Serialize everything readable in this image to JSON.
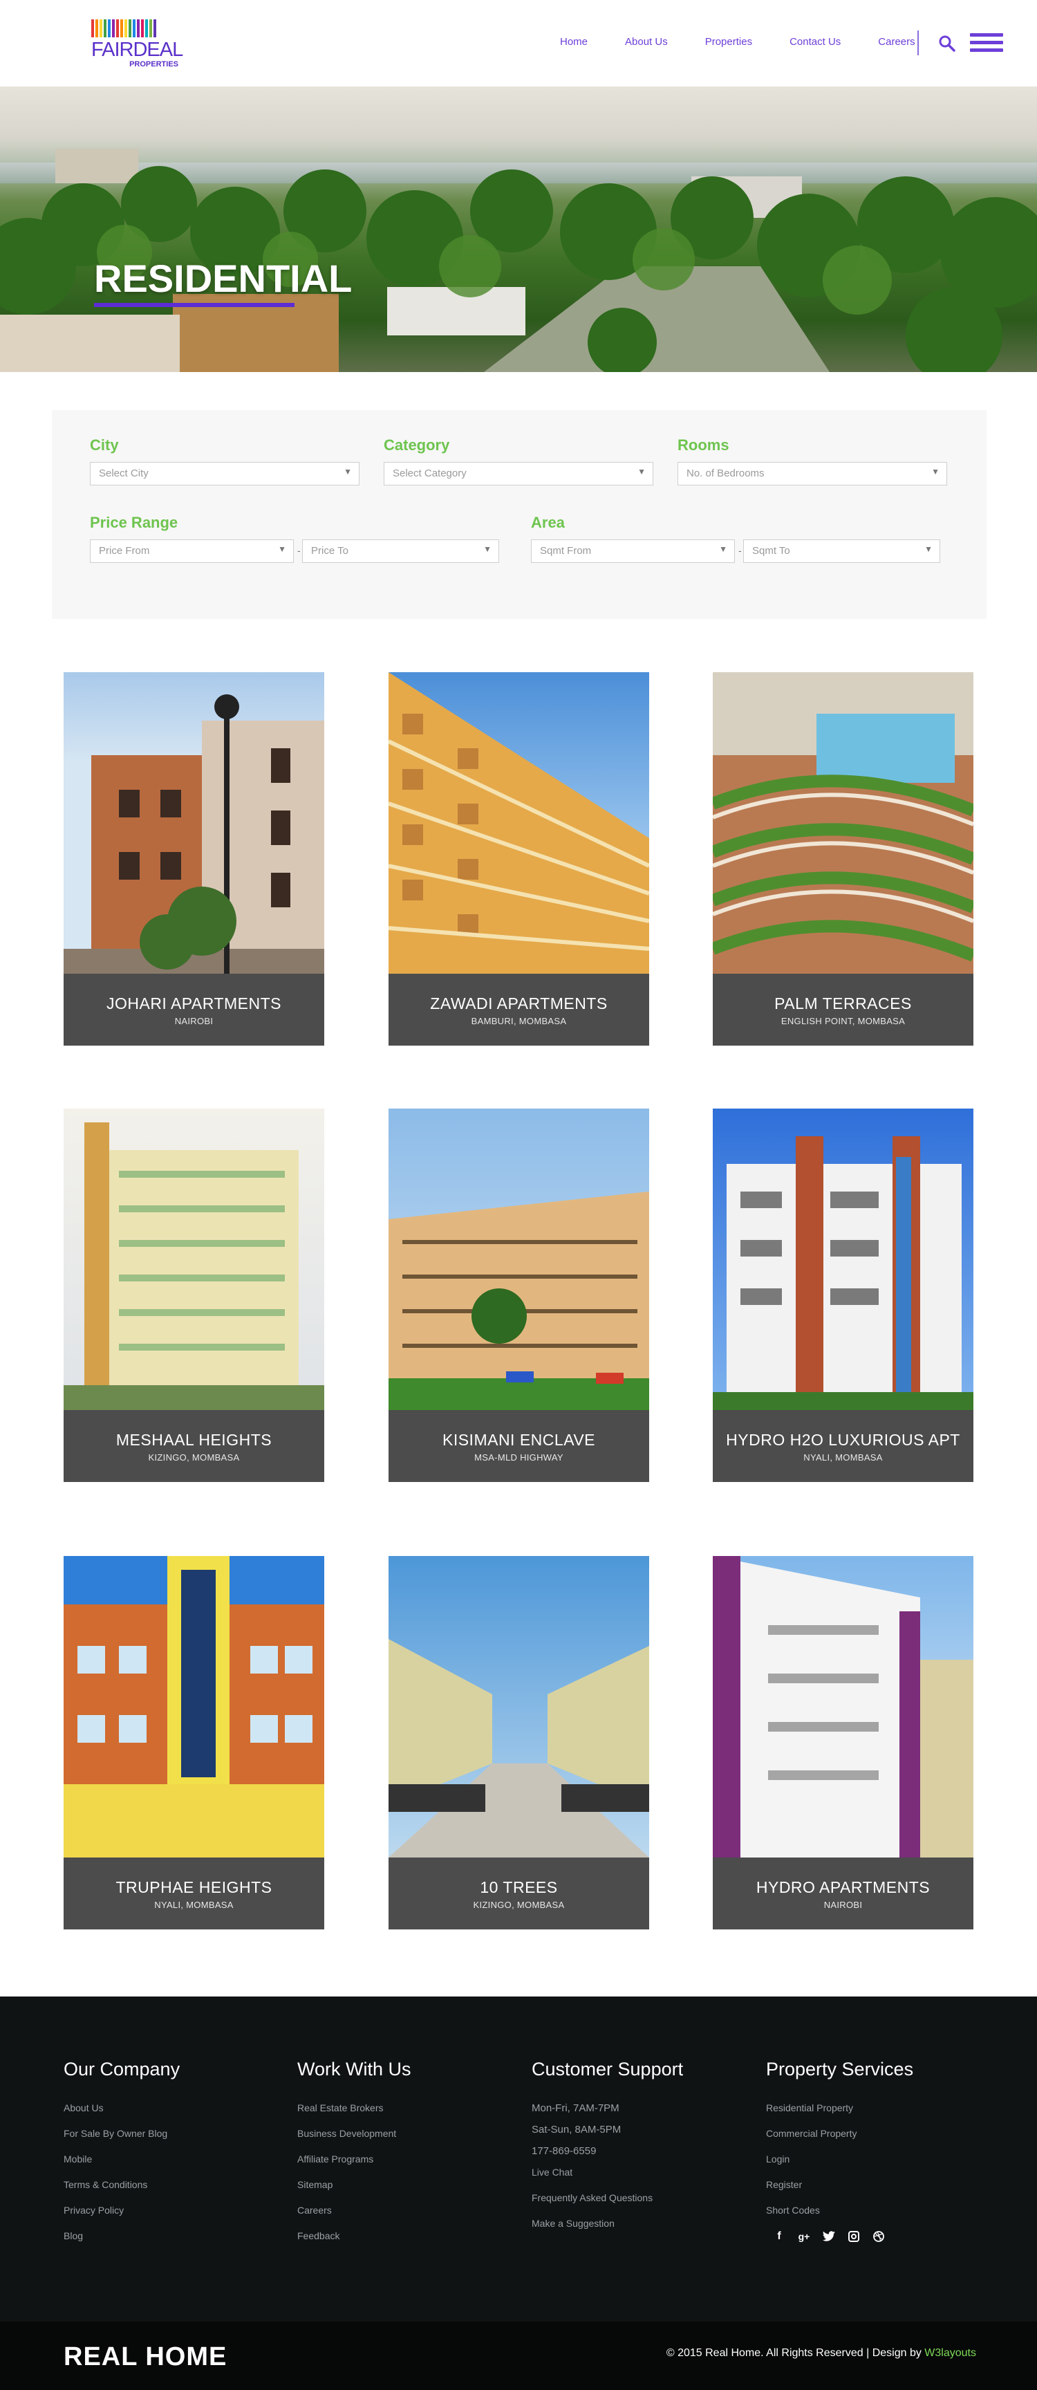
{
  "header": {
    "logo": {
      "name": "FAIRDEAL",
      "sub": "PROPERTIES"
    },
    "nav": [
      "Home",
      "About Us",
      "Properties",
      "Contact Us",
      "Careers"
    ],
    "icons": [
      "search-icon",
      "hamburger-menu-icon"
    ],
    "colors": {
      "accent": "#6d3fd8"
    }
  },
  "hero": {
    "title": "RESIDENTIAL"
  },
  "filter": {
    "city": {
      "label": "City",
      "placeholder": "Select City"
    },
    "category": {
      "label": "Category",
      "placeholder": "Select Category"
    },
    "rooms": {
      "label": "Rooms",
      "placeholder": "No. of Bedrooms"
    },
    "price": {
      "label": "Price Range",
      "from": "Price From",
      "to": "Price To"
    },
    "area": {
      "label": "Area",
      "from": "Sqmt From",
      "to": "Sqmt To"
    },
    "label_color": "#6ec44f"
  },
  "properties": [
    {
      "title": "JOHARI APARTMENTS",
      "location": "NAIROBI"
    },
    {
      "title": "ZAWADI APARTMENTS",
      "location": "BAMBURI, MOMBASA"
    },
    {
      "title": "PALM TERRACES",
      "location": "ENGLISH POINT, MOMBASA"
    },
    {
      "title": "MESHAAL HEIGHTS",
      "location": "KIZINGO, MOMBASA"
    },
    {
      "title": "KISIMANI ENCLAVE",
      "location": "MSA-MLD HIGHWAY"
    },
    {
      "title": "HYDRO H2O LUXURIOUS APT",
      "location": "NYALI, MOMBASA"
    },
    {
      "title": "TRUPHAE HEIGHTS",
      "location": "NYALI, MOMBASA"
    },
    {
      "title": "10 TREES",
      "location": "KIZINGO, MOMBASA"
    },
    {
      "title": "HYDRO APARTMENTS",
      "location": "NAIROBI"
    }
  ],
  "footer": {
    "company": {
      "title": "Our Company",
      "links": [
        "About Us",
        "For Sale By Owner Blog",
        "Mobile",
        "Terms & Conditions",
        "Privacy Policy",
        "Blog"
      ]
    },
    "work": {
      "title": "Work With Us",
      "links": [
        "Real Estate Brokers",
        "Business Development",
        "Affiliate Programs",
        "Sitemap",
        "Careers",
        "Feedback"
      ]
    },
    "support": {
      "title": "Customer Support",
      "hours1": "Mon-Fri, 7AM-7PM",
      "hours2": "Sat-Sun, 8AM-5PM",
      "phone": "177-869-6559",
      "links": [
        "Live Chat",
        "Frequently Asked Questions",
        "Make a Suggestion"
      ]
    },
    "services": {
      "title": "Property Services",
      "links": [
        "Residential Property",
        "Commercial Property",
        "Login",
        "Register",
        "Short Codes"
      ]
    },
    "social": [
      "facebook-icon",
      "google-plus-icon",
      "twitter-icon",
      "instagram-icon",
      "dribbble-icon"
    ],
    "brand": "REAL HOME",
    "copyright": "© 2015 Real Home. All Rights Reserved | Design by ",
    "designer": "W3layouts"
  }
}
